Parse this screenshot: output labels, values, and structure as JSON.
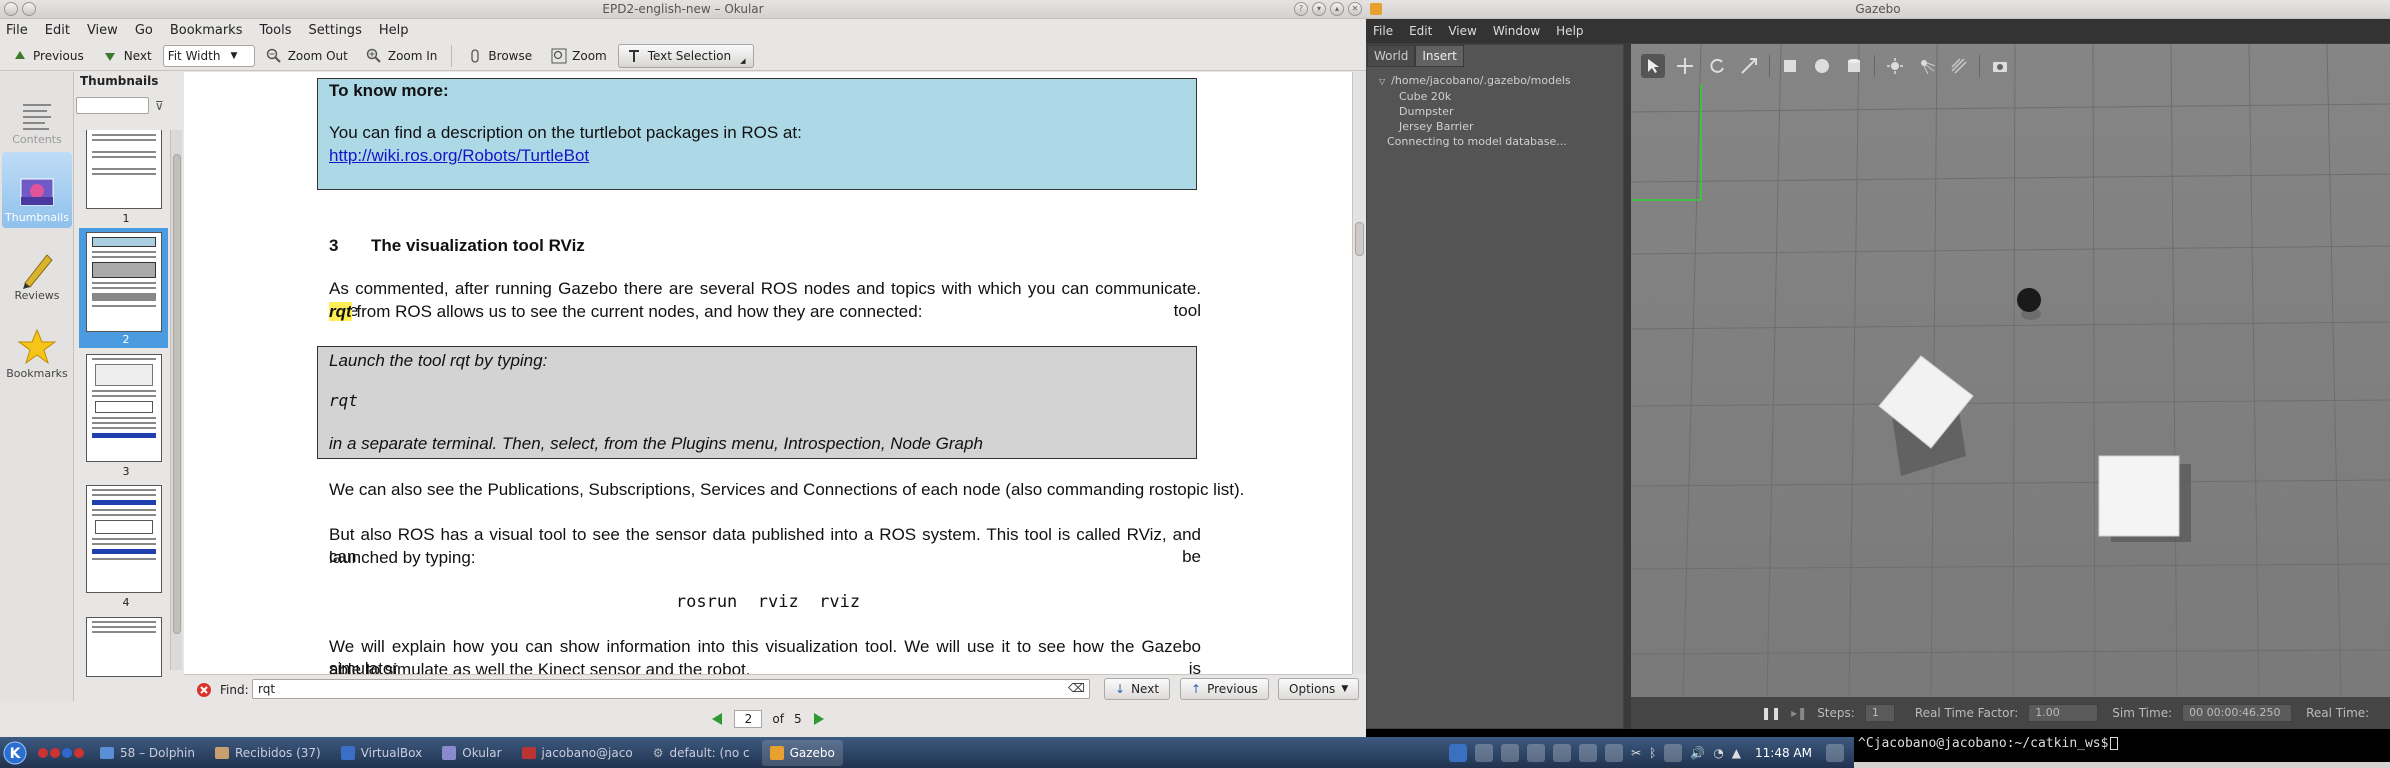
{
  "okular": {
    "window_title": "EPD2-english-new – Okular",
    "menu": [
      "File",
      "Edit",
      "View",
      "Go",
      "Bookmarks",
      "Tools",
      "Settings",
      "Help"
    ],
    "toolbar": {
      "previous": "Previous",
      "next": "Next",
      "zoom_mode": "Fit Width",
      "zoom_out": "Zoom Out",
      "zoom_in": "Zoom In",
      "browse": "Browse",
      "zoom": "Zoom",
      "text_selection": "Text Selection"
    },
    "sidebar_tabs": [
      "Contents",
      "Thumbnails",
      "Reviews",
      "Bookmarks"
    ],
    "thumbnails_title": "Thumbnails",
    "thumbnail_pages": [
      "1",
      "2",
      "3",
      "4"
    ],
    "document": {
      "box1_title": "To know more:",
      "box1_text": "You can find a description on the turtlebot packages in ROS at:",
      "box1_link": "http://wiki.ros.org/Robots/TurtleBot",
      "section_number": "3",
      "section_title": "The visualization tool RViz",
      "para1_line1": "As commented, after running Gazebo there are several ROS nodes and topics with which you can communicate. The tool",
      "para1_hl": "rqt",
      "para1_line2": " from ROS allows us to see the current nodes, and how they are connected:",
      "box2_line1": "Launch the tool rqt by typing:",
      "box2_cmd": "rqt",
      "box2_line3": "in a separate terminal. Then, select, from the Plugins menu, Introspection, Node Graph",
      "para2": "We can also see the Publications, Subscriptions, Services and Connections of each node (also commanding rostopic list).",
      "para3_line1": "But also ROS has a visual tool to see the sensor data published into a ROS system. This tool is called RViz, and can be",
      "para3_line2": "launched by typing:",
      "cmd": "rosrun  rviz  rviz",
      "para4_line1": "We will explain how you can show information into this visualization tool. We will use it to see how the Gazebo simulator is",
      "para4_line2": "able to simulate as well the Kinect sensor and the robot."
    },
    "find": {
      "label": "Find:",
      "value": "rqt",
      "next": "Next",
      "previous": "Previous",
      "options": "Options"
    },
    "page": {
      "current": "2",
      "of": "of",
      "total": "5"
    }
  },
  "gazebo": {
    "window_title": "Gazebo",
    "menu": [
      "File",
      "Edit",
      "View",
      "Window",
      "Help"
    ],
    "tabs": [
      "World",
      "Insert"
    ],
    "tree": {
      "root": "/home/jacobano/.gazebo/models",
      "items": [
        "Cube 20k",
        "Dumpster",
        "Jersey Barrier"
      ],
      "status": "Connecting to model database..."
    },
    "statusbar": {
      "steps_label": "Steps:",
      "steps_value": "1",
      "rtf_label": "Real Time Factor:",
      "rtf_value": "1.00",
      "sim_label": "Sim Time:",
      "sim_value": "00 00:00:46.250",
      "real_label": "Real Time:"
    }
  },
  "terminal": {
    "prompt": "^Cjacobano@jacobano:~/catkin_ws$"
  },
  "taskbar": {
    "tasks": [
      "58 – Dolphin",
      "Recibidos (37)",
      "VirtualBox",
      "Okular",
      "jacobano@jaco",
      "default: (no c",
      "Gazebo"
    ],
    "active_task": "Gazebo",
    "clock": "11:48 AM"
  },
  "colors": {
    "doc_blue_box": "#add8e6",
    "doc_gray_box": "#d3d3d3",
    "highlight": "#ffee55",
    "thumb_selected": "#4a9be0",
    "gazebo_bg": "#7e7e7e",
    "taskbar": "#2b4164"
  }
}
